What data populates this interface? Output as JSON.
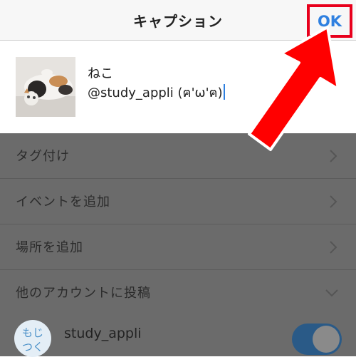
{
  "header": {
    "title": "キャプション",
    "ok_label": "OK"
  },
  "caption": {
    "line1": "ねこ",
    "line2": "@study_appli (ฅ'ω'ฅ)"
  },
  "settings": [
    {
      "label": "タグ付け",
      "icon": "chevron-right-icon"
    },
    {
      "label": "イベントを追加",
      "icon": "chevron-right-icon"
    },
    {
      "label": "場所を追加",
      "icon": "chevron-right-icon"
    },
    {
      "label": "他のアカウントに投稿",
      "icon": "chevron-down-icon"
    }
  ],
  "account": {
    "name": "study_appli",
    "avatar_text": "もじつく",
    "toggle_on": true
  },
  "colors": {
    "ok_blue": "#2f80e0",
    "highlight_red": "#e8001c",
    "overlay": "#6b6b6b",
    "toggle": "#2a5a87"
  }
}
